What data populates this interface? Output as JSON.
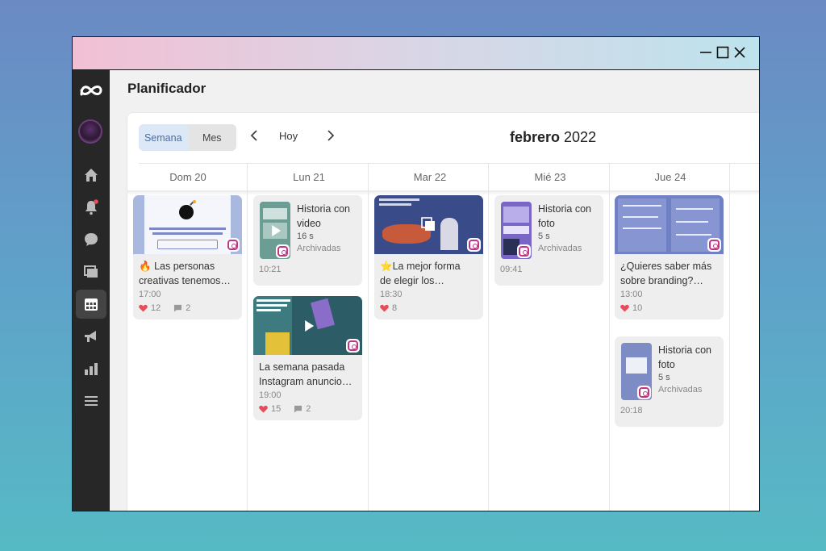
{
  "window": {
    "controls": {
      "minimize_icon": "minimize-icon",
      "maximize_icon": "maximize-icon",
      "close_icon": "close-icon"
    }
  },
  "sidebar": {
    "logo_icon": "meta-logo-icon",
    "items": [
      {
        "icon": "home-icon"
      },
      {
        "icon": "notifications-bell-icon",
        "badge_color": "#e94b5a"
      },
      {
        "icon": "messages-icon"
      },
      {
        "icon": "content-icon"
      },
      {
        "icon": "calendar-planner-icon",
        "active": true
      },
      {
        "icon": "ads-megaphone-icon"
      },
      {
        "icon": "insights-chart-icon"
      },
      {
        "icon": "menu-icon"
      }
    ]
  },
  "page": {
    "title": "Planificador"
  },
  "toolbar": {
    "view_week": "Semana",
    "view_month": "Mes",
    "today": "Hoy",
    "month_name": "febrero",
    "year": "2022"
  },
  "days": [
    "Dom 20",
    "Lun 21",
    "Mar 22",
    "Mié 23",
    "Jue 24"
  ],
  "posts": {
    "sun_1": {
      "emoji": "🔥",
      "caption_1": "Las personas",
      "caption_2": "creativas tenemos…",
      "time": "17:00",
      "likes": "12",
      "comments": "2"
    },
    "mon_story": {
      "title_1": "Historia con",
      "title_2": "video",
      "duration": "16 s",
      "status": "Archivadas",
      "time": "10:21"
    },
    "mon_2": {
      "caption_1": "La semana pasada",
      "caption_2": "Instagram anuncio…",
      "time": "19:00",
      "likes": "15",
      "comments": "2"
    },
    "tue_1": {
      "emoji": "⭐",
      "caption_1": "La mejor forma",
      "caption_2": "de elegir los…",
      "time": "18:30",
      "likes": "8"
    },
    "wed_story": {
      "title_1": "Historia con",
      "title_2": "foto",
      "duration": "5 s",
      "status": "Archivadas",
      "time": "09:41"
    },
    "thu_1": {
      "caption_1": "¿Quieres saber más",
      "caption_2": "sobre branding?…",
      "time": "13:00",
      "likes": "10"
    },
    "thu_story": {
      "title_1": "Historia con",
      "title_2": "foto",
      "duration": "5 s",
      "status": "Archivadas",
      "time": "20:18"
    }
  },
  "colors": {
    "accent": "#4a6fa0",
    "like": "#e94b5a",
    "instagram": "#c13584"
  }
}
